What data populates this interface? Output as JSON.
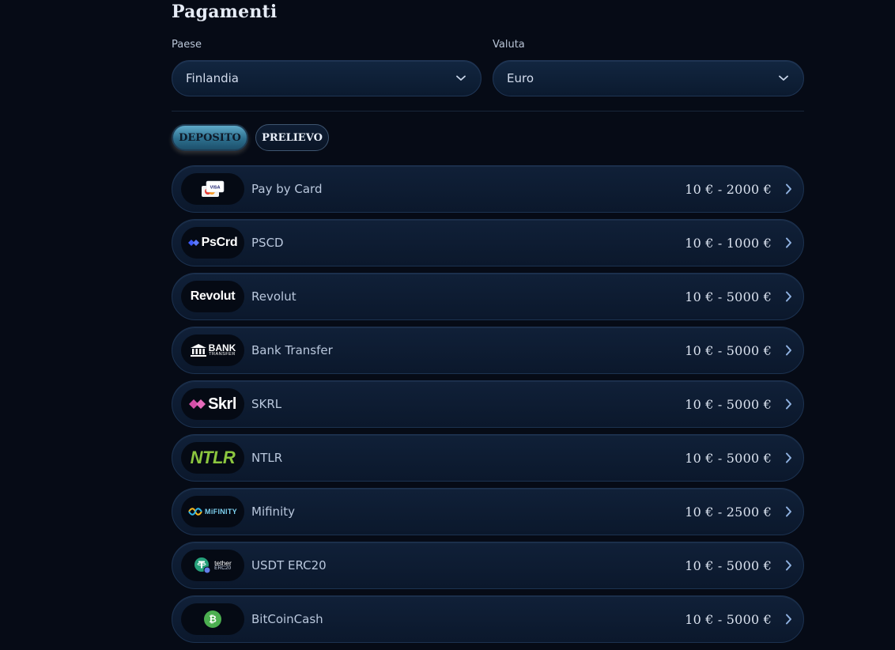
{
  "title": "Pagamenti",
  "country": {
    "label": "Paese",
    "value": "Finlandia"
  },
  "currency": {
    "label": "Valuta",
    "value": "Euro"
  },
  "tabs": {
    "deposit": "DEPOSITO",
    "withdraw": "PRELIEVO"
  },
  "methods": [
    {
      "name": "Pay by Card",
      "limits": "10 € - 2000 €",
      "icon": "card-icon",
      "logo_text": "VISA"
    },
    {
      "name": "PSCD",
      "limits": "10 € - 1000 €",
      "icon": "pscrd-logo",
      "logo_text": "PsCrd"
    },
    {
      "name": "Revolut",
      "limits": "10 € - 5000 €",
      "icon": "revolut-logo",
      "logo_text": "Revolut"
    },
    {
      "name": "Bank Transfer",
      "limits": "10 € - 5000 €",
      "icon": "bank-transfer-logo",
      "logo_text": "BANK",
      "logo_subtext": "TRANSFER"
    },
    {
      "name": "SKRL",
      "limits": "10 € - 5000 €",
      "icon": "skrl-logo",
      "logo_text": "Skrl"
    },
    {
      "name": "NTLR",
      "limits": "10 € - 5000 €",
      "icon": "ntlr-logo",
      "logo_text": "NTLR"
    },
    {
      "name": "Mifinity",
      "limits": "10 € - 2500 €",
      "icon": "mifinity-logo",
      "logo_text": "MiFINITY"
    },
    {
      "name": "USDT ERC20",
      "limits": "10 € - 5000 €",
      "icon": "tether-logo",
      "logo_text": "tether",
      "logo_subtext": "ERC20"
    },
    {
      "name": "BitCoinCash",
      "limits": "10 € - 5000 €",
      "icon": "bitcoin-cash-logo",
      "logo_text": "₿"
    }
  ],
  "colors": {
    "background": "#060b16",
    "accent_tab": "#3f8eb0",
    "ntlr_green": "#8cc63f",
    "skrl_pink": "#d44fa8",
    "pscrd_blue": "#3d5bff",
    "tether_teal": "#26a17b",
    "bch_green": "#4caf50"
  }
}
